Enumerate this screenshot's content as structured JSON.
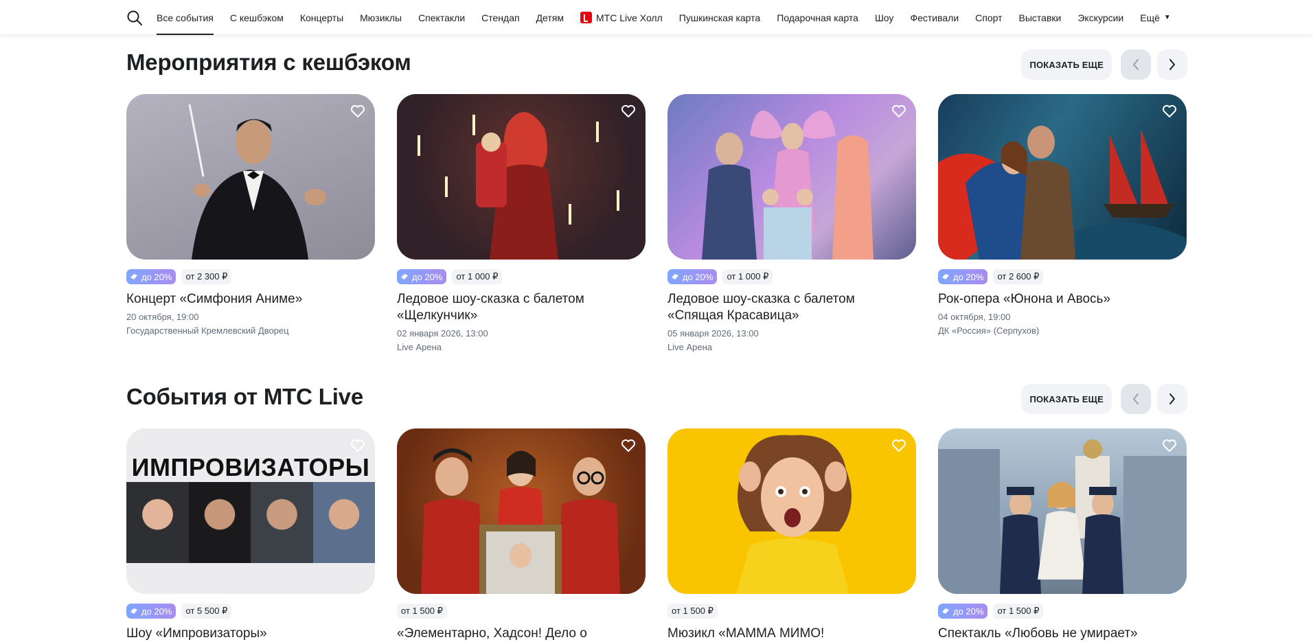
{
  "nav": {
    "items": [
      {
        "label": "Все события",
        "active": true
      },
      {
        "label": "С кешбэком"
      },
      {
        "label": "Концерты"
      },
      {
        "label": "Мюзиклы"
      },
      {
        "label": "Спектакли"
      },
      {
        "label": "Стендап"
      },
      {
        "label": "Детям"
      },
      {
        "label": "МТС Live Холл",
        "icon": "mts-live-logo-icon"
      },
      {
        "label": "Пушкинская карта"
      },
      {
        "label": "Подарочная карта"
      },
      {
        "label": "Шоу"
      },
      {
        "label": "Фестивали"
      },
      {
        "label": "Спорт"
      },
      {
        "label": "Выставки"
      },
      {
        "label": "Экскурсии"
      }
    ],
    "more_label": "Ещё"
  },
  "sections": [
    {
      "title": "Мероприятия с кешбэком",
      "show_more_label": "ПОКАЗАТЬ ЕЩЕ",
      "cards": [
        {
          "cashback": "до 20%",
          "price": "от 2 300 ₽",
          "title": "Концерт «Симфония Аниме»",
          "date": "20 октября, 19:00",
          "venue": "Государственный Кремлевский Дворец"
        },
        {
          "cashback": "до 20%",
          "price": "от 1 000 ₽",
          "title": "Ледовое шоу-сказка с балетом «Щелкунчик»",
          "date": "02 января 2026, 13:00",
          "venue": "Live Арена"
        },
        {
          "cashback": "до 20%",
          "price": "от 1 000 ₽",
          "title": "Ледовое шоу-сказка с балетом «Спящая Красавица»",
          "date": "05 января 2026, 13:00",
          "venue": "Live Арена"
        },
        {
          "cashback": "до 20%",
          "price": "от 2 600 ₽",
          "title": "Рок-опера «Юнона и Авось»",
          "date": "04 октября, 19:00",
          "venue": "ДК «Россия» (Серпухов)"
        }
      ]
    },
    {
      "title": "События от МТС Live",
      "show_more_label": "ПОКАЗАТЬ ЕЩЕ",
      "cards": [
        {
          "cashback": "до 20%",
          "price": "от 5 500 ₽",
          "title": "Шоу «Импровизаторы»",
          "image_text": "ИМПРОВИЗАТОРЫ"
        },
        {
          "cashback": "",
          "price": "от 1 500 ₽",
          "title": "«Элементарно, Хадсон! Дело о"
        },
        {
          "cashback": "",
          "price": "от 1 500 ₽",
          "title": "Мюзикл «МАММА МИМО!"
        },
        {
          "cashback": "до 20%",
          "price": "от 1 500 ₽",
          "title": "Спектакль «Любовь не умирает»"
        }
      ]
    }
  ],
  "colors": {
    "accent_text": "#1d2023",
    "muted": "#626c77",
    "chip_bg": "#f2f3f7",
    "mts_red": "#e30611"
  }
}
